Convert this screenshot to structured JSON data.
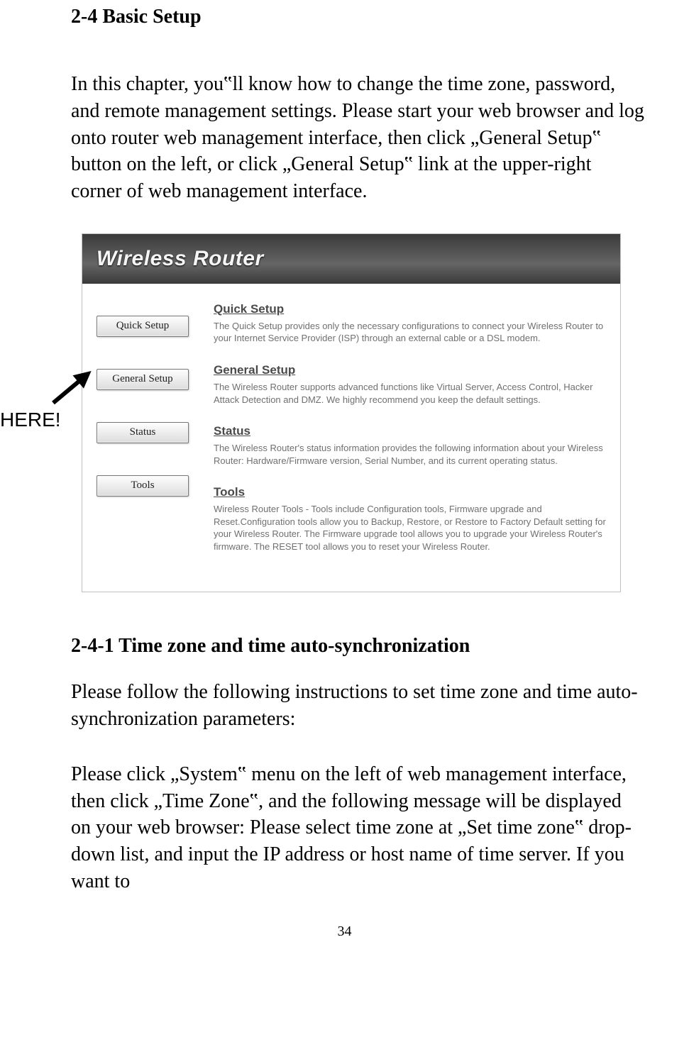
{
  "section_title": "2-4 Basic Setup",
  "intro_text": "In this chapter, you‟ll know how to change the time zone, password, and remote management settings. Please start your web browser and log onto router web management interface, then click „General Setup‟ button on the left, or click „General Setup‟ link at the upper-right corner of web management interface.",
  "here_label": "HERE!",
  "router": {
    "header_title": "Wireless Router",
    "sidebar_buttons": [
      "Quick Setup",
      "General Setup",
      "Status",
      "Tools"
    ],
    "sections": [
      {
        "title": "Quick Setup",
        "desc": "The Quick Setup provides only the necessary configurations to connect your Wireless Router to your Internet Service Provider (ISP) through an external cable or a DSL modem."
      },
      {
        "title": "General Setup",
        "desc": "The Wireless Router supports advanced functions like Virtual Server, Access Control, Hacker Attack Detection and DMZ. We highly recommend you keep the default settings."
      },
      {
        "title": "Status",
        "desc": "The Wireless Router's status information provides the following information about your Wireless Router: Hardware/Firmware version, Serial Number, and its current operating status."
      },
      {
        "title": "Tools",
        "desc": "Wireless Router Tools - Tools include Configuration tools, Firmware upgrade and Reset.Configuration tools allow you to Backup, Restore, or Restore to Factory Default setting for your Wireless Router. The Firmware upgrade tool allows you to upgrade your Wireless Router's firmware. The RESET tool allows you to reset your Wireless Router."
      }
    ]
  },
  "sub_title": "2-4-1 Time zone and time auto-synchronization",
  "body_p1": "Please follow the following instructions to set time zone and time auto-synchronization parameters:",
  "body_p2": "Please click „System‟ menu on the left of web management interface, then click „Time Zone‟, and the following message will be displayed on your web browser: Please select time zone at „Set time zone‟ drop-down list, and input the IP address or host name of time server. If you want to",
  "page_number": "34"
}
